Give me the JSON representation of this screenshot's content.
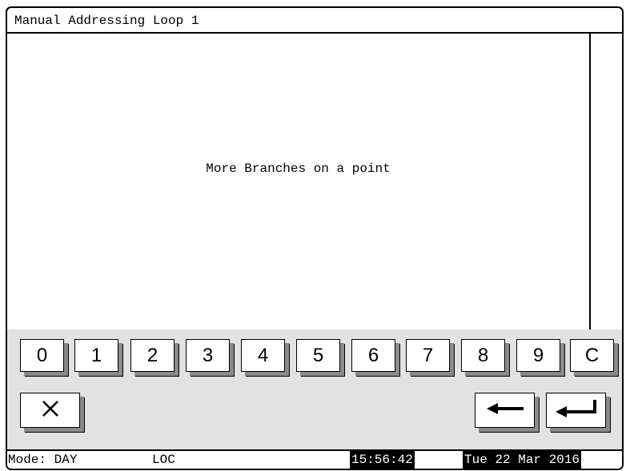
{
  "window": {
    "title": "Manual Addressing Loop 1"
  },
  "main": {
    "message": "More Branches on a point"
  },
  "keypad": {
    "keys": [
      "0",
      "1",
      "2",
      "3",
      "4",
      "5",
      "6",
      "7",
      "8",
      "9",
      "C"
    ]
  },
  "actions": {
    "cancel_icon": "close-icon",
    "backspace_icon": "arrow-left-icon",
    "enter_icon": "enter-return-icon"
  },
  "status": {
    "mode": "Mode: DAY",
    "location": "LOC",
    "time": "15:56:42",
    "date": "Tue 22 Mar 2016"
  }
}
